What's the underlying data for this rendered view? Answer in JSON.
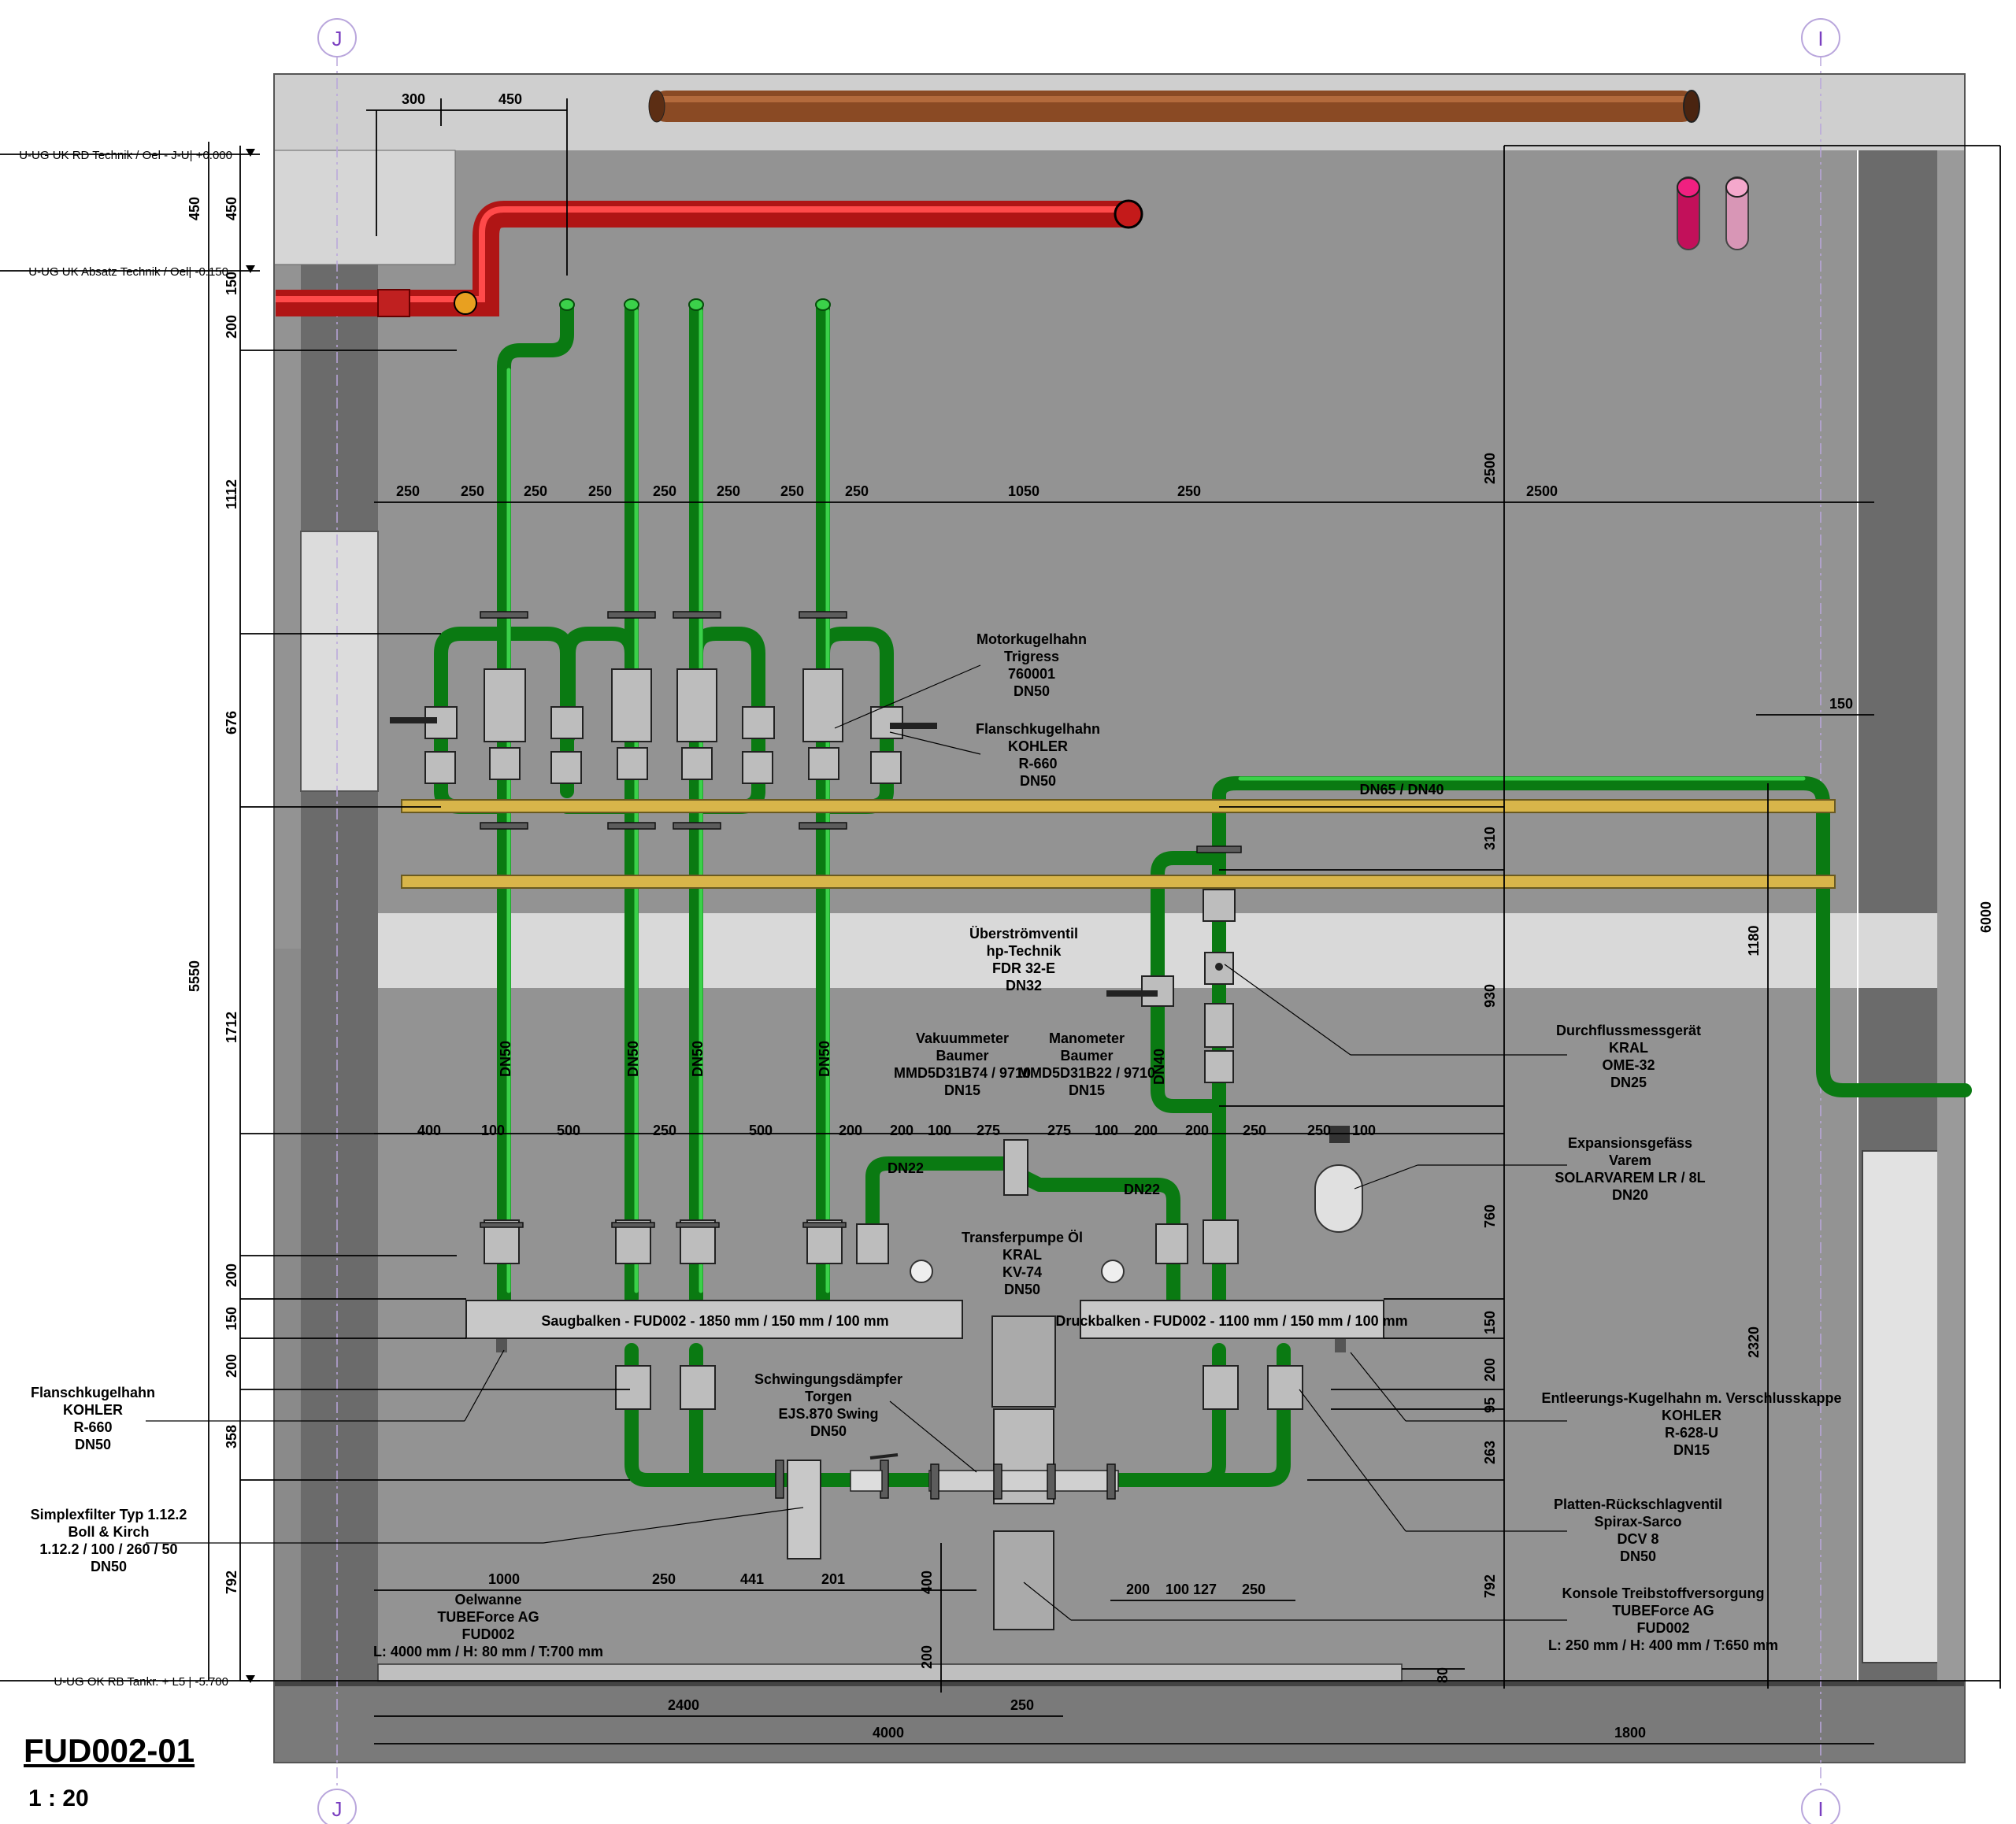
{
  "drawing": {
    "title": "FUD002-01",
    "scale": "1 : 20",
    "grid_labels": [
      "J",
      "I"
    ],
    "colors": {
      "background_wall": "#939393",
      "concrete": "#6b6b6b",
      "pipe_green": "#0a7a12",
      "pipe_red": "#d42020",
      "support_yellow": "#d8b54a"
    }
  },
  "levels": [
    {
      "text": "U-UG UK RD Technik / Oel - J-U| +0.000"
    },
    {
      "text": "U-UG UK Absatz Technik / Oel| -0.150"
    },
    {
      "text": "U-UG OK RB Tankr. + L5 | -5.700"
    }
  ],
  "dims": {
    "top_300": "300",
    "top_450": "450",
    "left_450a": "450",
    "left_450b": "450",
    "left_150": "150",
    "left_200": "200",
    "left_1112": "1112",
    "left_676": "676",
    "left_5550": "5550",
    "left_1712": "1712",
    "left_200b": "200",
    "left_150b": "150",
    "left_200c": "200",
    "left_358": "358",
    "left_792": "792",
    "r1": [
      "250",
      "250",
      "250",
      "250",
      "250",
      "250",
      "250",
      "250",
      "1050",
      "250",
      "2500"
    ],
    "v2500": "2500",
    "r2": [
      "400",
      "100",
      "500",
      "250",
      "500",
      "200",
      "200",
      "100",
      "275",
      "275",
      "100",
      "200",
      "200",
      "250",
      "250",
      "100"
    ],
    "dn50": "DN50",
    "dn40": "DN40",
    "dn22": "DN22",
    "dn65": "DN65 / DN40",
    "v310": "310",
    "v930": "930",
    "v760": "760",
    "v150": "150",
    "v200": "200",
    "v95": "95",
    "v263": "263",
    "v792": "792",
    "v1180": "1180",
    "v2320": "2320",
    "v6000": "6000",
    "h150": "150",
    "b1000": "1000",
    "b250": "250",
    "b441": "441",
    "b201": "201",
    "b400": "400",
    "b200v": "200",
    "b200": "200",
    "b100": "100",
    "b127": "127",
    "b250r": "250",
    "b80": "80",
    "bottom_2400": "2400",
    "bottom_250": "250",
    "bottom_4000": "4000",
    "bottom_1800": "1800"
  },
  "labels": {
    "motor": [
      "Motorkugelhahn",
      "Trigress",
      "760001",
      "DN50"
    ],
    "flansch_top": [
      "Flanschkugelhahn",
      "KOHLER",
      "R-660",
      "DN50"
    ],
    "ueberstrom": [
      "Überströmventil",
      "hp-Technik",
      "FDR 32-E",
      "DN32"
    ],
    "durchfluss": [
      "Durchflussmessgerät",
      "KRAL",
      "OME-32",
      "DN25"
    ],
    "vakuum": [
      "Vakuummeter",
      "Baumer",
      "MMD5D31B74 / 9710",
      "DN15"
    ],
    "mano": [
      "Manometer",
      "Baumer",
      "MMD5D31B22 / 9710",
      "DN15"
    ],
    "expansion": [
      "Expansionsgefäss",
      "Varem",
      "SOLARVAREM LR / 8L",
      "DN20"
    ],
    "transfer": [
      "Transferpumpe Öl",
      "KRAL",
      "KV-74",
      "DN50"
    ],
    "saug": "Saugbalken - FUD002 - 1850 mm / 150 mm / 100 mm",
    "druck": "Druckbalken - FUD002 - 1100 mm / 150 mm / 100 mm",
    "schwing": [
      "Schwingungsdämpfer",
      "Torgen",
      "EJS.870 Swing",
      "DN50"
    ],
    "flansch_left": [
      "Flanschkugelhahn",
      "KOHLER",
      "R-660",
      "DN50"
    ],
    "simplex": [
      "Simplexfilter Typ 1.12.2",
      "Boll & Kirch",
      "1.12.2 / 100 / 260 / 50",
      "DN50"
    ],
    "entleer": [
      "Entleerungs-Kugelhahn m. Verschlusskappe",
      "KOHLER",
      "R-628-U",
      "DN15"
    ],
    "platten": [
      "Platten-Rückschlagventil",
      "Spirax-Sarco",
      "DCV 8",
      "DN50"
    ],
    "konsole": [
      "Konsole Treibstoffversorgung",
      "TUBEForce AG",
      "FUD002",
      "L: 250 mm / H: 400 mm / T:650 mm"
    ],
    "oelwanne": [
      "Oelwanne",
      "TUBEForce AG",
      "FUD002",
      "L: 4000 mm / H: 80 mm / T:700 mm"
    ]
  }
}
